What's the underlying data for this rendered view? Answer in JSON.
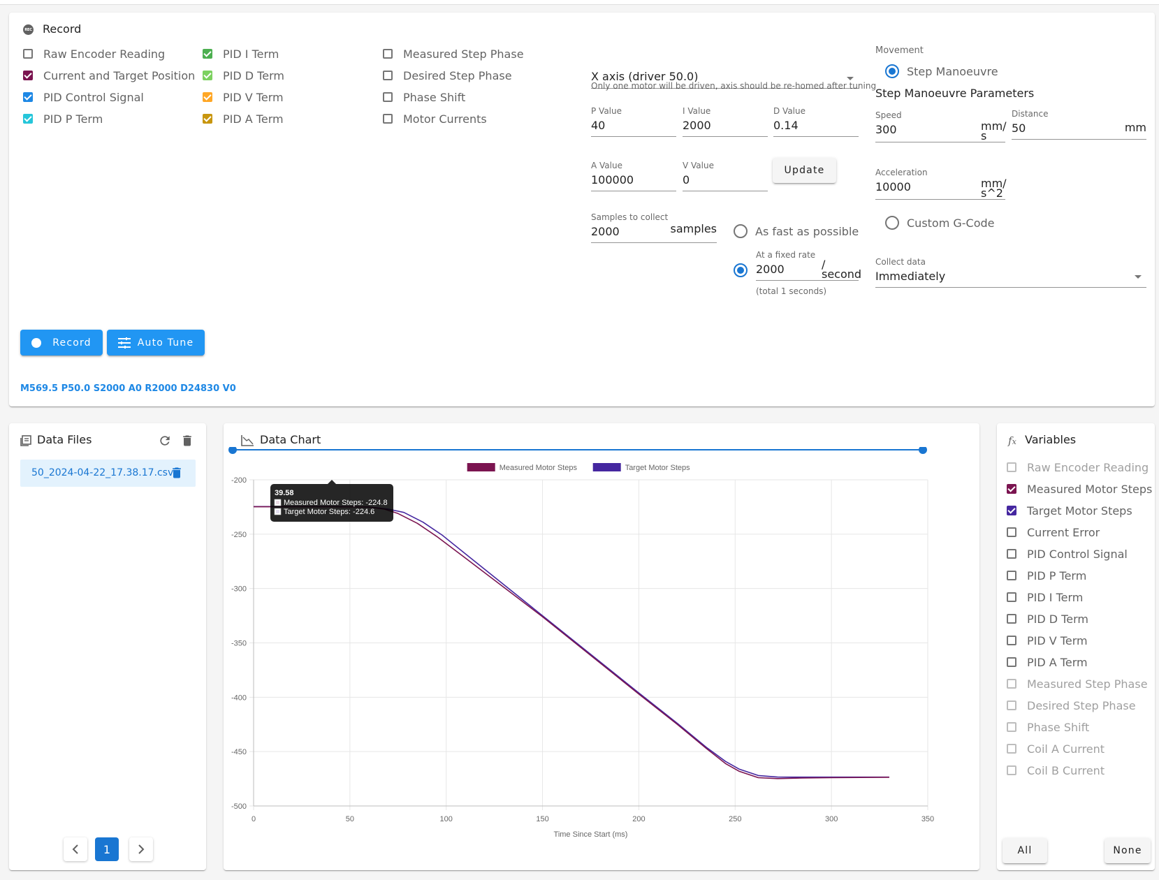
{
  "record": {
    "title": "Record",
    "checkboxes": [
      {
        "label": "Raw Encoder Reading",
        "checked": false
      },
      {
        "label": "Current and Target Position",
        "checked": true,
        "color": "#7b1450"
      },
      {
        "label": "PID Control Signal",
        "checked": true,
        "color": "#1e88e5"
      },
      {
        "label": "PID P Term",
        "checked": true,
        "color": "#26c6da"
      },
      {
        "label": "PID I Term",
        "checked": true,
        "color": "#4caf50"
      },
      {
        "label": "PID D Term",
        "checked": true,
        "color": "#7cd160"
      },
      {
        "label": "PID V Term",
        "checked": true,
        "color": "#ffa726"
      },
      {
        "label": "PID A Term",
        "checked": true,
        "color": "#c8960f"
      },
      {
        "label": "Measured Step Phase",
        "checked": false
      },
      {
        "label": "Desired Step Phase",
        "checked": false
      },
      {
        "label": "Phase Shift",
        "checked": false
      },
      {
        "label": "Motor Currents",
        "checked": false
      }
    ],
    "axis_select": {
      "value": "X axis (driver 50.0)",
      "hint": "Only one motor will be driven, axis should be re-homed after tuning"
    },
    "p_value": {
      "label": "P Value",
      "value": "40"
    },
    "i_value": {
      "label": "I Value",
      "value": "2000"
    },
    "d_value": {
      "label": "D Value",
      "value": "0.14"
    },
    "a_value": {
      "label": "A Value",
      "value": "100000"
    },
    "v_value": {
      "label": "V Value",
      "value": "0"
    },
    "update_label": "Update",
    "samples": {
      "label": "Samples to collect",
      "value": "2000",
      "suffix": "samples"
    },
    "rate_fast": {
      "label": "As fast as possible",
      "selected": false
    },
    "rate_fixed": {
      "label": "At a fixed rate",
      "value": "2000",
      "suffix": "/\nsecond",
      "hint": "(total 1 seconds)",
      "selected": true
    },
    "movement": {
      "label": "Movement",
      "step_option": "Step Manoeuvre",
      "step_selected": true,
      "params_title": "Step Manoeuvre Parameters",
      "speed": {
        "label": "Speed",
        "value": "300",
        "suffix": "mm/\ns"
      },
      "distance": {
        "label": "Distance",
        "value": "50",
        "suffix": "mm"
      },
      "acceleration": {
        "label": "Acceleration",
        "value": "10000",
        "suffix": "mm/\ns^2"
      },
      "custom_option": "Custom G-Code",
      "custom_selected": false
    },
    "collect": {
      "label": "Collect data",
      "value": "Immediately"
    },
    "record_button": "Record",
    "autotune_button": "Auto Tune",
    "gcode": "M569.5 P50.0 S2000 A0 R2000 D24830 V0"
  },
  "data_files": {
    "title": "Data Files",
    "files": [
      "50_2024-04-22_17.38.17.csv"
    ],
    "page": "1"
  },
  "chart": {
    "title": "Data Chart"
  },
  "chart_data": {
    "type": "line",
    "xlabel": "Time Since Start (ms)",
    "ylabel": "",
    "xlim": [
      0,
      350
    ],
    "ylim": [
      -500,
      -200
    ],
    "x_ticks": [
      "0",
      "50",
      "100",
      "150",
      "200",
      "250",
      "300",
      "350"
    ],
    "y_ticks": [
      "-200",
      "-250",
      "-300",
      "-350",
      "-400",
      "-450",
      "-500"
    ],
    "grid": true,
    "legend_position": "top-center",
    "series": [
      {
        "name": "Measured Motor Steps",
        "color": "#7b1450",
        "points": [
          [
            0,
            -224.8
          ],
          [
            39.58,
            -224.8
          ],
          [
            60,
            -225
          ],
          [
            68,
            -227
          ],
          [
            75,
            -231
          ],
          [
            85,
            -240
          ],
          [
            95,
            -252
          ],
          [
            110,
            -272
          ],
          [
            150,
            -326
          ],
          [
            200,
            -397
          ],
          [
            220,
            -425
          ],
          [
            235,
            -447
          ],
          [
            245,
            -461
          ],
          [
            252,
            -468
          ],
          [
            262,
            -474
          ],
          [
            272,
            -474.8
          ],
          [
            285,
            -474.3
          ],
          [
            300,
            -474
          ],
          [
            330,
            -473.6
          ]
        ]
      },
      {
        "name": "Target Motor Steps",
        "color": "#4527a0",
        "points": [
          [
            0,
            -224.6
          ],
          [
            39.58,
            -224.6
          ],
          [
            60,
            -225
          ],
          [
            70,
            -227
          ],
          [
            78,
            -230
          ],
          [
            88,
            -239
          ],
          [
            98,
            -251
          ],
          [
            112,
            -271
          ],
          [
            150,
            -325
          ],
          [
            200,
            -396
          ],
          [
            220,
            -424
          ],
          [
            235,
            -446
          ],
          [
            245,
            -459
          ],
          [
            252,
            -466
          ],
          [
            262,
            -472
          ],
          [
            272,
            -473.4
          ],
          [
            285,
            -473.5
          ],
          [
            300,
            -473.5
          ],
          [
            330,
            -473.5
          ]
        ]
      }
    ],
    "range_slider": [
      0,
      1
    ],
    "tooltip": {
      "x": "39.58",
      "lines": [
        "Measured Motor Steps: -224.8",
        "Target Motor Steps: -224.6"
      ]
    }
  },
  "variables": {
    "title": "Variables",
    "items": [
      {
        "label": "Raw Encoder Reading",
        "checked": false,
        "disabled": true
      },
      {
        "label": "Measured Motor Steps",
        "checked": true,
        "color": "#7b1450"
      },
      {
        "label": "Target Motor Steps",
        "checked": true,
        "color": "#4527a0"
      },
      {
        "label": "Current Error",
        "checked": false
      },
      {
        "label": "PID Control Signal",
        "checked": false
      },
      {
        "label": "PID P Term",
        "checked": false
      },
      {
        "label": "PID I Term",
        "checked": false
      },
      {
        "label": "PID D Term",
        "checked": false
      },
      {
        "label": "PID V Term",
        "checked": false
      },
      {
        "label": "PID A Term",
        "checked": false
      },
      {
        "label": "Measured Step Phase",
        "checked": false,
        "disabled": true
      },
      {
        "label": "Desired Step Phase",
        "checked": false,
        "disabled": true
      },
      {
        "label": "Phase Shift",
        "checked": false,
        "disabled": true
      },
      {
        "label": "Coil A Current",
        "checked": false,
        "disabled": true
      },
      {
        "label": "Coil B Current",
        "checked": false,
        "disabled": true
      }
    ],
    "all_label": "All",
    "none_label": "None"
  }
}
